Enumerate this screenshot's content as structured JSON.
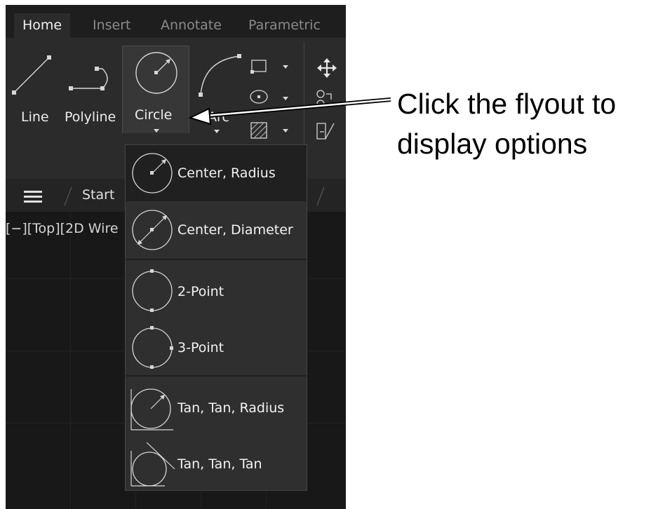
{
  "tabs": [
    "Home",
    "Insert",
    "Annotate",
    "Parametric"
  ],
  "ribbon": {
    "line_label": "Line",
    "polyline_label": "Polyline",
    "circle_label": "Circle",
    "arc_label": "Arc"
  },
  "document_bar": {
    "start_label": "Start"
  },
  "viewport": {
    "controls": "[−][Top][2D Wire"
  },
  "circle_flyout": {
    "items": [
      {
        "label": "Center, Radius",
        "icon": "circle-center-radius-icon"
      },
      {
        "label": "Center, Diameter",
        "icon": "circle-center-diameter-icon"
      },
      {
        "label": "2-Point",
        "icon": "circle-2-point-icon"
      },
      {
        "label": "3-Point",
        "icon": "circle-3-point-icon"
      },
      {
        "label": "Tan, Tan, Radius",
        "icon": "circle-tan-tan-radius-icon"
      },
      {
        "label": "Tan, Tan, Tan",
        "icon": "circle-tan-tan-tan-icon"
      }
    ]
  },
  "callout": {
    "line1": "Click the flyout to",
    "line2": "display options"
  },
  "colors": {
    "ribbon_bg": "#2b2b2b",
    "tabbar_bg": "#1e1e1e",
    "viewport_bg": "#181818",
    "flyout_bg": "#2f2f2f",
    "highlight_bg": "#373737"
  }
}
